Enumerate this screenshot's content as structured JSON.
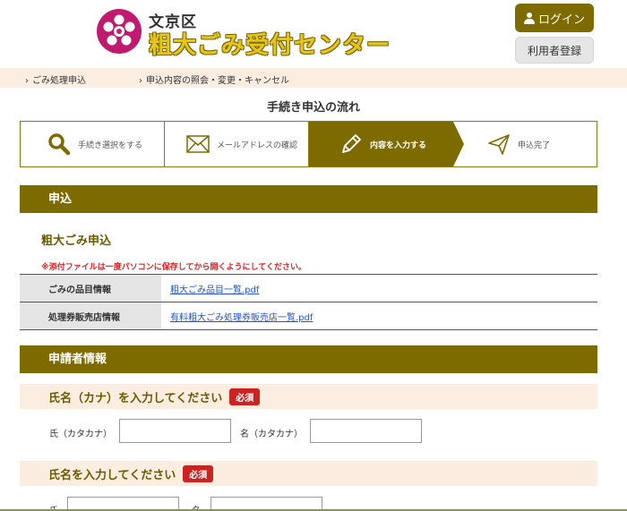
{
  "header": {
    "ward_name": "文京区",
    "center_name": "粗大ごみ受付センター",
    "login_label": "ログイン",
    "register_label": "利用者登録"
  },
  "subnav": {
    "items": [
      {
        "label": "ごみ処理申込"
      },
      {
        "label": "申込内容の照会・変更・キャンセル"
      }
    ]
  },
  "flow": {
    "title": "手続き申込の流れ",
    "steps": [
      {
        "label": "手続き選択をする",
        "icon": "search-icon"
      },
      {
        "label": "メールアドレスの確認",
        "icon": "envelope-icon"
      },
      {
        "label": "内容を入力する",
        "icon": "pencil-icon",
        "active": true
      },
      {
        "label": "申込完了",
        "icon": "paper-plane-icon"
      }
    ]
  },
  "application": {
    "section_title": "申込",
    "heading": "粗大ごみ申込",
    "notice": "※添付ファイルは一度パソコンに保存してから開くようにしてください。",
    "rows": [
      {
        "label": "ごみの品目情報",
        "link": "粗大ごみ品目一覧.pdf"
      },
      {
        "label": "処理券販売店情報",
        "link": "有料粗大ごみ処理券販売店一覧.pdf"
      }
    ]
  },
  "applicant": {
    "section_title": "申請者情報",
    "kana_group": {
      "title": "氏名（カナ）を入力してください",
      "required": "必須",
      "last_label": "氏（カタカナ）",
      "first_label": "名（カタカナ）",
      "last_value": "",
      "first_value": ""
    },
    "name_group": {
      "title": "氏名を入力してください",
      "required": "必須",
      "last_label": "氏",
      "first_label": "名",
      "last_value": "",
      "first_value": ""
    }
  },
  "colors": {
    "brand": "#7d6b00",
    "logo": "#c0196f",
    "required": "#cc2222",
    "link": "#2255cc"
  }
}
